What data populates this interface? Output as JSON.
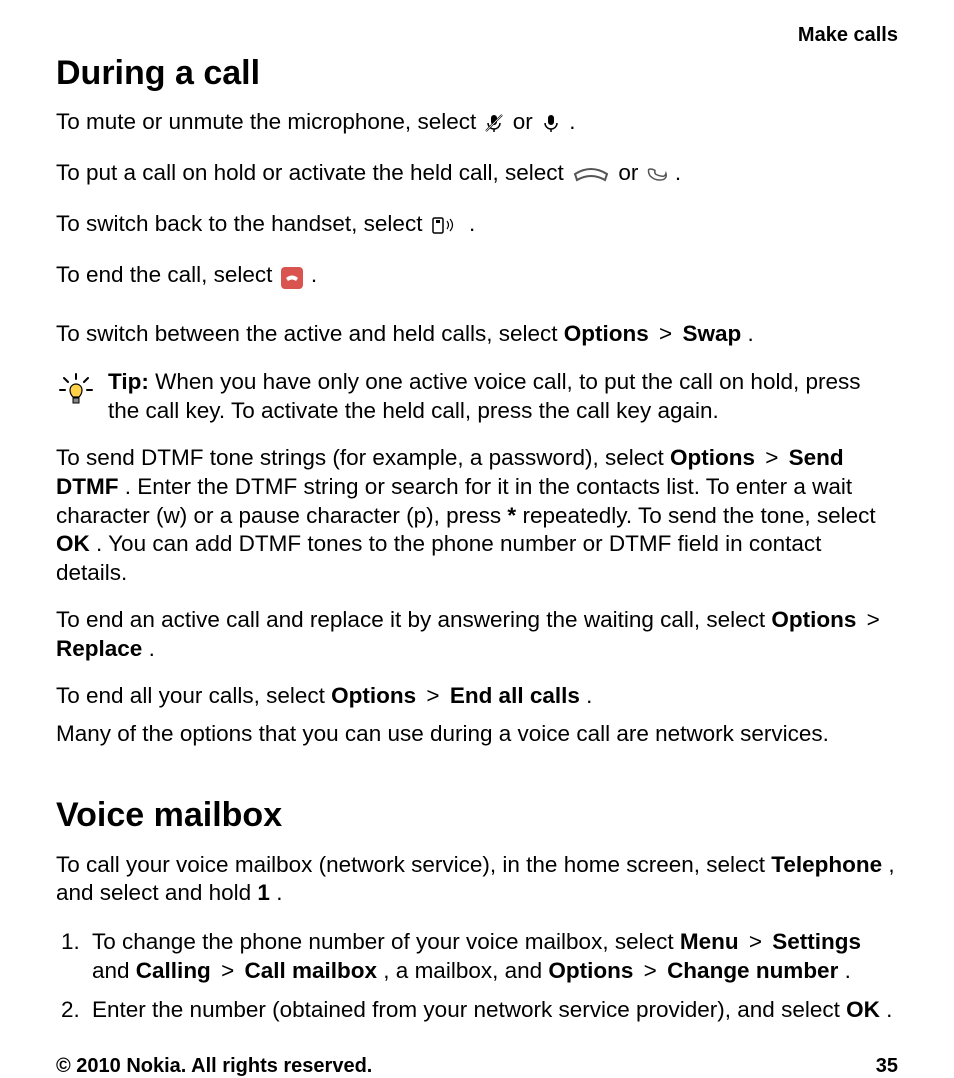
{
  "header": {
    "section": "Make calls"
  },
  "during": {
    "title": "During a call",
    "p1a": "To mute or unmute the microphone, select ",
    "p1b": " or ",
    "p1c": ".",
    "p2a": "To put a call on hold or activate the held call, select ",
    "p2b": " or ",
    "p2c": ".",
    "p3a": "To switch back to the handset, select ",
    "p3b": ".",
    "p4a": "To end the call, select ",
    "p4b": ".",
    "swap_a": "To switch between the active and held calls, select ",
    "swap_opt": "Options",
    "swap_sep": ">",
    "swap_b": "Swap",
    "swap_c": ".",
    "tip_label": "Tip:",
    "tip_text": " When you have only one active voice call, to put the call on hold, press the call key. To activate the held call, press the call key again.",
    "dtmf_a": "To send DTMF tone strings (for example, a password), select ",
    "dtmf_opt": "Options",
    "dtmf_sep": ">",
    "dtmf_send": "Send DTMF",
    "dtmf_b": ". Enter the DTMF string or search for it in the contacts list. To enter a wait character (w) or a pause character (p), press ",
    "dtmf_star": "*",
    "dtmf_c": " repeatedly. To send the tone, select ",
    "dtmf_ok": "OK",
    "dtmf_d": ". You can add DTMF tones to the phone number or DTMF field in contact details.",
    "replace_a": "To end an active call and replace it by answering the waiting call, select ",
    "replace_opt": "Options",
    "replace_sep": ">",
    "replace_b": "Replace",
    "replace_c": ".",
    "endall_a": "To end all your calls, select ",
    "endall_opt": "Options",
    "endall_sep": ">",
    "endall_b": "End all calls",
    "endall_c": ".",
    "note": "Many of the options that you can use during a voice call are network services."
  },
  "voicemail": {
    "title": "Voice mailbox",
    "intro_a": "To call your voice mailbox (network service), in the home screen, select ",
    "intro_tel": "Telephone",
    "intro_b": ", and select and hold ",
    "intro_one": "1",
    "intro_c": ".",
    "step1_a": "To change the phone number of your voice mailbox, select ",
    "step1_menu": "Menu",
    "step1_sep": ">",
    "step1_settings": "Settings",
    "step1_and": " and ",
    "step1_calling": "Calling",
    "step1_callmbx": "Call mailbox",
    "step1_mid": ", a mailbox, and ",
    "step1_options": "Options",
    "step1_change": "Change number",
    "step1_end": ".",
    "step2_a": "Enter the number (obtained from your network service provider), and select ",
    "step2_ok": "OK",
    "step2_b": "."
  },
  "footer": {
    "copyright": "© 2010 Nokia. All rights reserved.",
    "page": "35"
  }
}
